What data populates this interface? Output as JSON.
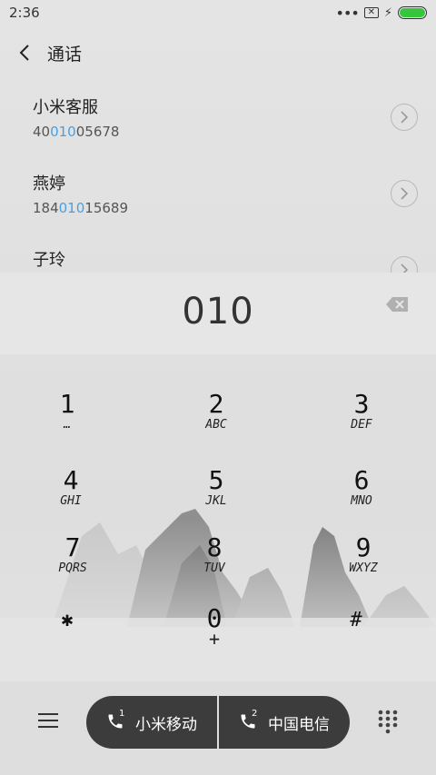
{
  "status_bar": {
    "time": "2:36"
  },
  "header": {
    "title": "通话"
  },
  "contacts": [
    {
      "name": "小米客服",
      "number_pre": "40",
      "number_match": "010",
      "number_post": "05678"
    },
    {
      "name": "燕婷",
      "number_pre": "184",
      "number_match": "010",
      "number_post": "15689"
    },
    {
      "name": "子玲"
    }
  ],
  "dialer": {
    "number": "010"
  },
  "keypad": {
    "keys": [
      {
        "digit": "1",
        "letters": "…"
      },
      {
        "digit": "2",
        "letters": "ABC"
      },
      {
        "digit": "3",
        "letters": "DEF"
      },
      {
        "digit": "4",
        "letters": "GHI"
      },
      {
        "digit": "5",
        "letters": "JKL"
      },
      {
        "digit": "6",
        "letters": "MNO"
      },
      {
        "digit": "7",
        "letters": "PQRS"
      },
      {
        "digit": "8",
        "letters": "TUV"
      },
      {
        "digit": "9",
        "letters": "WXYZ"
      },
      {
        "digit": "✱",
        "letters": ""
      },
      {
        "digit": "0",
        "letters": "+"
      },
      {
        "digit": "#",
        "letters": ""
      }
    ]
  },
  "bottom": {
    "sim1_label": "小米移动",
    "sim1_slot": "1",
    "sim2_label": "中国电信",
    "sim2_slot": "2"
  },
  "colors": {
    "highlight": "#4a9fe0",
    "call_button": "#3c3c3c",
    "battery": "#35c63c"
  },
  "icons": [
    "back-icon",
    "chevron-right-icon",
    "backspace-icon",
    "menu-icon",
    "phone-icon",
    "dialpad-icon",
    "sim-no-signal-icon",
    "charging-icon",
    "battery-icon"
  ]
}
